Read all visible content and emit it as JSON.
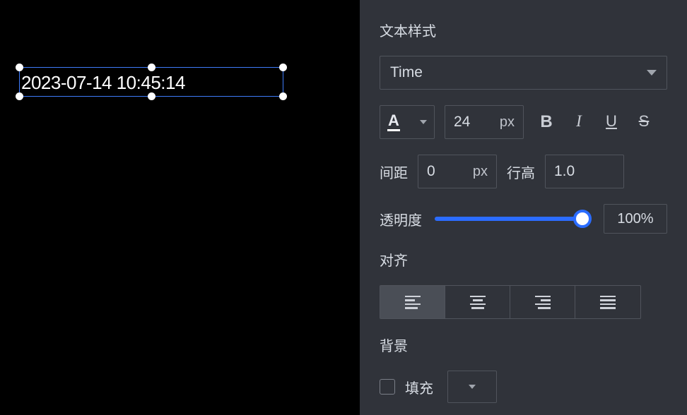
{
  "canvas": {
    "text": "2023-07-14 10:45:14"
  },
  "panel": {
    "textStyle": {
      "title": "文本样式",
      "font": "Time",
      "colorLabel": "A",
      "fontSize": "24",
      "fontUnit": "px",
      "bold": "B",
      "italic": "I",
      "underline": "U",
      "strike": "S",
      "spacingLabel": "间距",
      "spacing": "0",
      "spacingUnit": "px",
      "lineHeightLabel": "行高",
      "lineHeight": "1.0",
      "opacityLabel": "透明度",
      "opacity": "100%"
    },
    "align": {
      "title": "对齐"
    },
    "background": {
      "title": "背景",
      "fillLabel": "填充"
    }
  }
}
